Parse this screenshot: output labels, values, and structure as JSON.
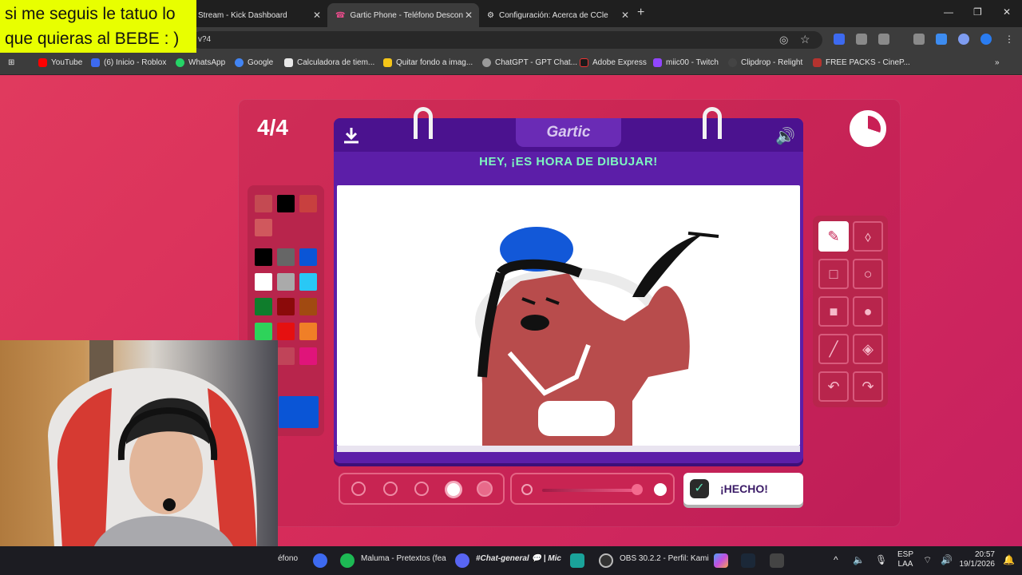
{
  "overlay": {
    "line1": "si me seguis le tatuo lo",
    "line2": "que quieras al BEBE : )"
  },
  "tabs": [
    {
      "label": "Stream - Kick Dashboard"
    },
    {
      "label": "Gartic Phone - Teléfono Descon"
    },
    {
      "label": "Configuración: Acerca de CCle"
    }
  ],
  "address": {
    "tail": "v?4"
  },
  "bookmarks": [
    {
      "label": "YouTube",
      "color": "#ff0000"
    },
    {
      "label": "(6) Inicio - Roblox",
      "color": "#3d6af0"
    },
    {
      "label": "WhatsApp",
      "color": "#25d366"
    },
    {
      "label": "Google",
      "color": "#4285f4"
    },
    {
      "label": "Calculadora de tiem...",
      "color": "#e8e8e8"
    },
    {
      "label": "Quitar fondo a imag...",
      "color": "#f5c518"
    },
    {
      "label": "ChatGPT - GPT Chat...",
      "color": "#9a9a9a"
    },
    {
      "label": "Adobe Express",
      "color": "#1a1a1a"
    },
    {
      "label": "miic00 - Twitch",
      "color": "#9146ff"
    },
    {
      "label": "Clipdrop - Relight",
      "color": "#444444"
    },
    {
      "label": "FREE PACKS - CineP...",
      "color": "#b5332f"
    }
  ],
  "game": {
    "round": "4/4",
    "logo": "Gartic",
    "prompt": "HEY, ¡ES HORA DE DIBUJAR!",
    "done_label": "¡HECHO!",
    "palette_top": [
      "#c44a52",
      "#000000",
      "#c8403f",
      "#d0585d"
    ],
    "palette": [
      "#000000",
      "#666666",
      "#0a55d6",
      "#ffffff",
      "#aaaaaa",
      "#29c8f5",
      "#0f7d2c",
      "#8b0a0a",
      "#a14a11",
      "#2ed35a",
      "#e51010",
      "#f07f27",
      "#a3154f",
      "#c04459",
      "#e0147a",
      "#f3a2b0"
    ],
    "selected_color": "#0a55d6",
    "tools": [
      "pencil",
      "eraser",
      "rect-outline",
      "circle-outline",
      "rect-fill",
      "circle-fill",
      "line",
      "fill",
      "undo",
      "redo"
    ]
  },
  "taskbar": {
    "items": [
      "éfono",
      "Maluma - Pretextos (fea",
      "#Chat-general 💬 | Mic",
      "OBS 30.2.2 - Perfil: Kami"
    ],
    "lang": "ESP",
    "lang2": "LAA",
    "time": "20:57",
    "date": "19/1/2026"
  }
}
